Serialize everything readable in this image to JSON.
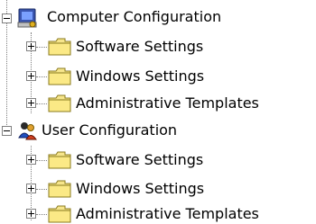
{
  "tree": {
    "computer_configuration": {
      "label": "Computer Configuration",
      "icon": "computer-config-icon",
      "expanded": true,
      "children": [
        {
          "label": "Software Settings",
          "icon": "folder-icon"
        },
        {
          "label": "Windows Settings",
          "icon": "folder-icon"
        },
        {
          "label": "Administrative Templates",
          "icon": "folder-icon"
        }
      ]
    },
    "user_configuration": {
      "label": "User Configuration",
      "icon": "user-config-icon",
      "expanded": true,
      "children": [
        {
          "label": "Software Settings",
          "icon": "folder-icon"
        },
        {
          "label": "Windows Settings",
          "icon": "folder-icon"
        },
        {
          "label": "Administrative Templates",
          "icon": "folder-icon"
        }
      ]
    }
  },
  "colors": {
    "folder_fill": "#f6e58b",
    "folder_edge": "#8a7a1e",
    "tree_line": "#808080"
  }
}
